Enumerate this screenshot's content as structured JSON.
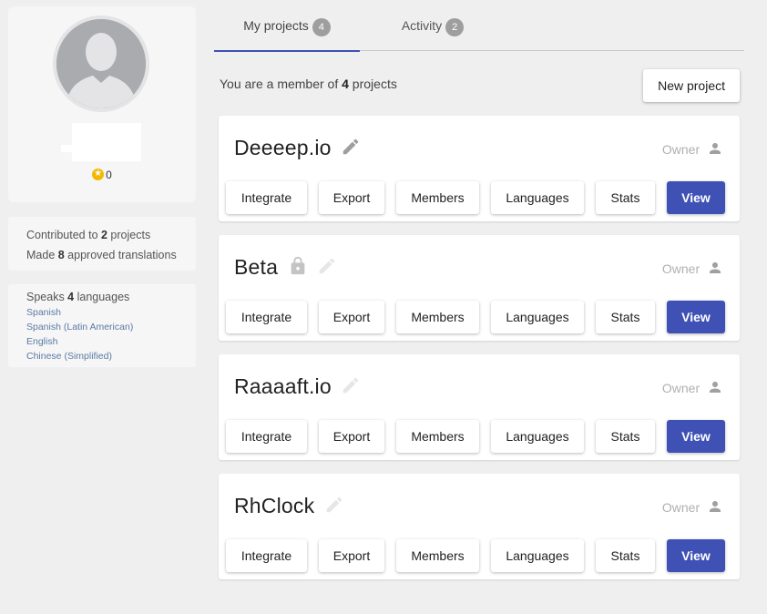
{
  "profile": {
    "reputation": "0"
  },
  "stats": {
    "contributed_prefix": "Contributed to ",
    "contributed_count": "2",
    "contributed_suffix": " projects",
    "approved_prefix": "Made ",
    "approved_count": "8",
    "approved_suffix": " approved translations"
  },
  "languages": {
    "title_prefix": "Speaks ",
    "count": "4",
    "title_suffix": " languages",
    "items": [
      "Spanish",
      "Spanish (Latin American)",
      "English",
      "Chinese (Simplified)"
    ]
  },
  "tabs": [
    {
      "label": "My projects",
      "badge": "4"
    },
    {
      "label": "Activity",
      "badge": "2"
    }
  ],
  "member": {
    "prefix": "You are a member of ",
    "count": "4",
    "suffix": " projects"
  },
  "new_project_label": "New project",
  "projects": [
    {
      "name": "Deeeep.io",
      "role": "Owner",
      "locked": false
    },
    {
      "name": "Beta",
      "role": "Owner",
      "locked": true
    },
    {
      "name": "Raaaaft.io",
      "role": "Owner",
      "locked": false
    },
    {
      "name": "RhClock",
      "role": "Owner",
      "locked": false
    }
  ],
  "actions": {
    "integrate": "Integrate",
    "export": "Export",
    "members": "Members",
    "languages": "Languages",
    "stats": "Stats",
    "view": "View"
  },
  "colors": {
    "accent": "#3f51b5",
    "star": "#f5b800",
    "badge": "#9e9e9e"
  }
}
